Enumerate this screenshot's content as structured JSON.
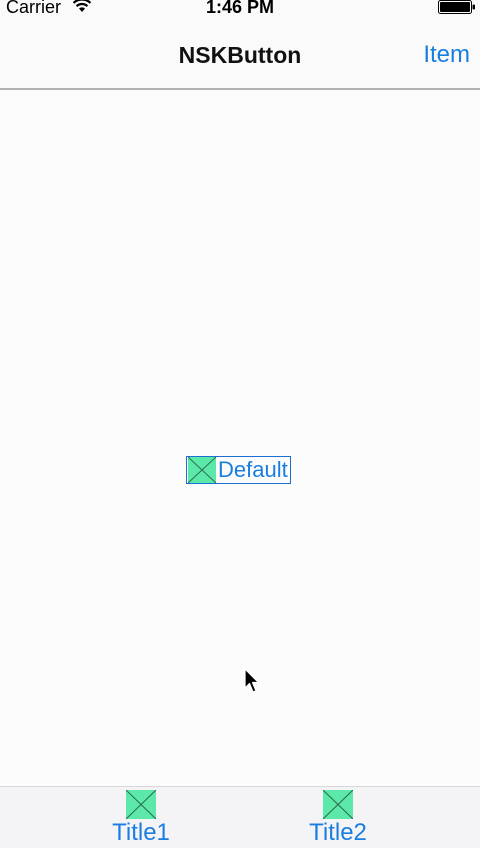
{
  "status_bar": {
    "carrier": "Carrier",
    "time": "1:46 PM",
    "wifi_icon": "wifi-icon",
    "battery_icon": "battery-icon"
  },
  "nav_bar": {
    "title": "NSKButton",
    "right_item": "Item"
  },
  "main": {
    "button_label": "Default",
    "button_icon": "placeholder-image-icon"
  },
  "bottom_bar": {
    "items": [
      {
        "label": "Title1",
        "icon": "placeholder-image-icon"
      },
      {
        "label": "Title2",
        "icon": "placeholder-image-icon"
      }
    ]
  },
  "colors": {
    "accent": "#1a7ee0",
    "placeholder_fill": "#5ce8a8"
  }
}
